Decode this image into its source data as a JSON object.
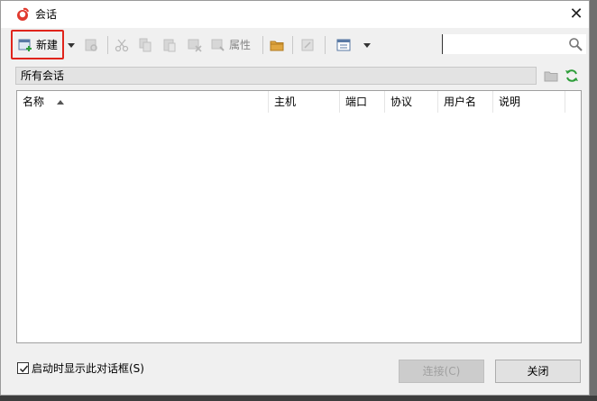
{
  "window": {
    "title": "会话",
    "close_icon": "close-icon"
  },
  "toolbar": {
    "new_label": "新建",
    "properties_label": "属性",
    "icons": [
      "new-session-icon",
      "dropdown-arrow-icon",
      "open-session-icon",
      "cut-icon",
      "copy-icon",
      "paste-icon",
      "delete-icon",
      "properties-icon",
      "new-folder-icon",
      "import-icon",
      "view-list-icon",
      "view-dropdown-icon"
    ]
  },
  "search": {
    "value": "",
    "placeholder": "",
    "icon": "search-icon"
  },
  "folder_bar": {
    "path": "所有会话",
    "icons": [
      "folder-up-icon",
      "refresh-icon"
    ]
  },
  "table": {
    "columns": [
      "名称",
      "主机",
      "端口",
      "协议",
      "用户名",
      "说明"
    ],
    "sort_column": "名称",
    "sort_direction": "ascending",
    "rows": []
  },
  "footer": {
    "show_on_startup_label": "启动时显示此对话框(S)",
    "show_on_startup_checked": true,
    "connect_label": "连接(C)",
    "close_label": "关闭"
  },
  "colors": {
    "highlight_border": "#e0241b",
    "refresh_green": "#2e9e3a",
    "logo_red": "#e03a2f"
  }
}
